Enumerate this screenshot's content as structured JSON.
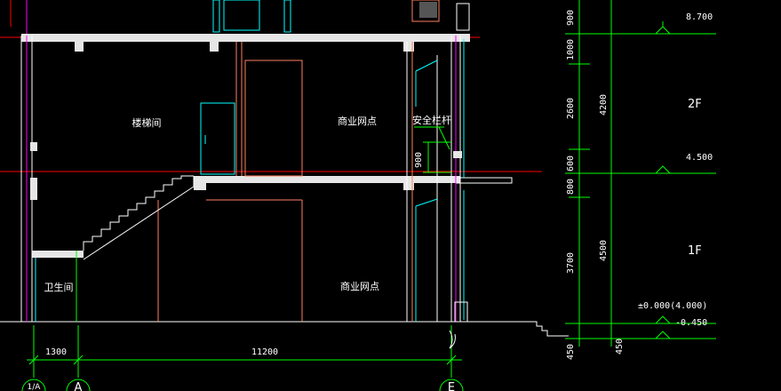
{
  "colors": {
    "background": "#000000",
    "wall": "#ffffff",
    "slab": "#e6e6e6",
    "dimension": "#00ff00",
    "axis_red": "#ff0000",
    "cyan": "#00ffff",
    "magenta": "#ff00ff",
    "brown": "#ff7f5f",
    "yellow_text": "#ffffff"
  },
  "rooms": {
    "stair_room": "楼梯间",
    "shop_upper": "商业网点",
    "shop_lower": "商业网点",
    "bathroom": "卫生间",
    "railing": "安全栏杆",
    "railing_height": "900"
  },
  "floors": {
    "second": "2F",
    "first": "1F"
  },
  "elevations": {
    "top": "8.700",
    "mid": "4.500",
    "ground": "±0.000(4.000)",
    "outside": "-0.450"
  },
  "vertical_dims": {
    "segments": [
      "900",
      "1000",
      "2600",
      "600",
      "800",
      "3700",
      "450"
    ],
    "totals": [
      "4200",
      "4500",
      "450"
    ]
  },
  "horizontal_dims": {
    "spans": [
      "1300",
      "11200"
    ]
  },
  "axes": {
    "left_partial": "1/A",
    "a": "A",
    "e": "E"
  }
}
